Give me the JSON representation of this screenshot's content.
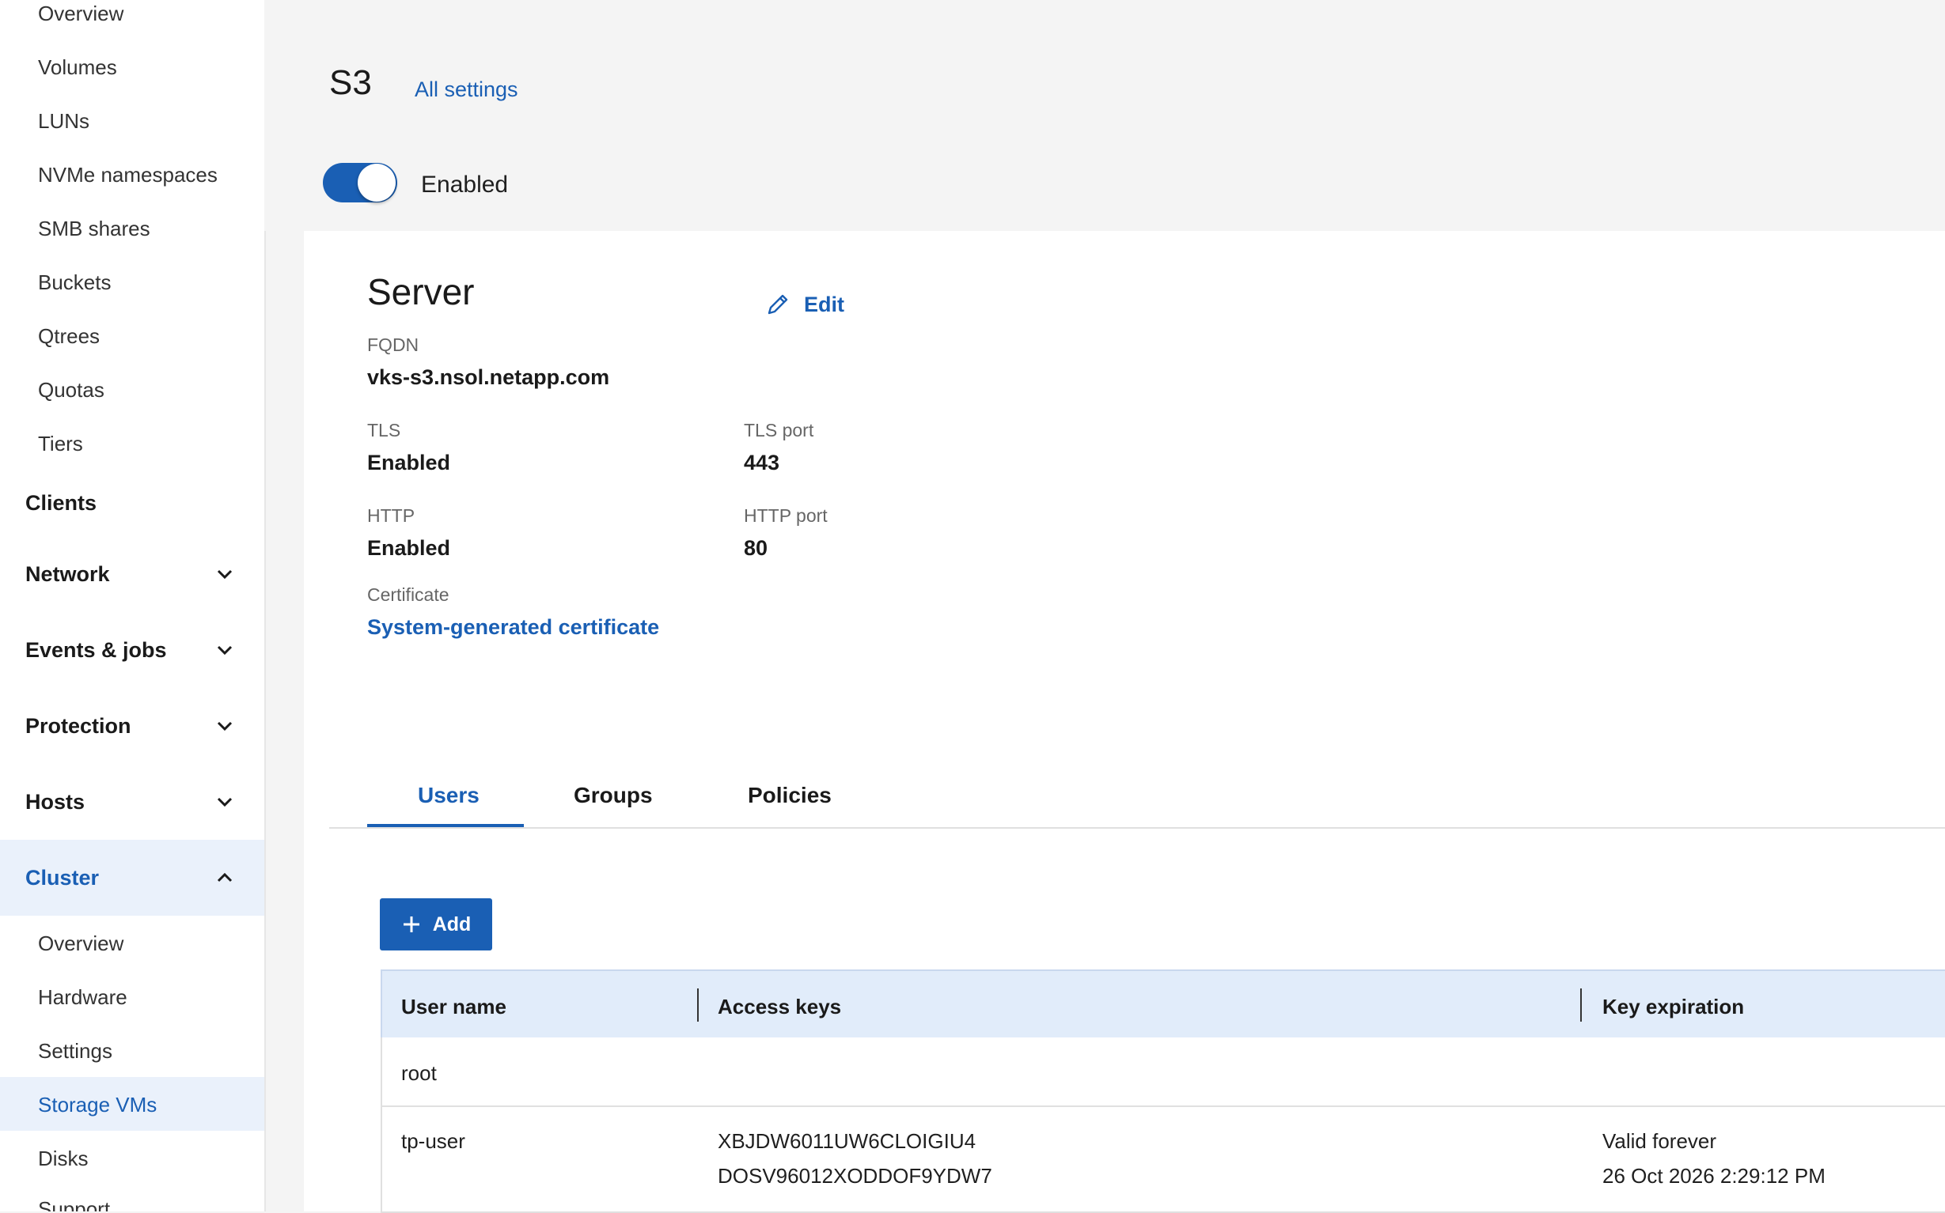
{
  "sidebar": {
    "storage_items": [
      "Overview",
      "Volumes",
      "LUNs",
      "NVMe namespaces",
      "SMB shares",
      "Buckets",
      "Qtrees",
      "Quotas",
      "Tiers"
    ],
    "sections": {
      "clients": "Clients",
      "network": "Network",
      "events": "Events & jobs",
      "protection": "Protection",
      "hosts": "Hosts",
      "cluster": "Cluster"
    },
    "cluster_items": [
      "Overview",
      "Hardware",
      "Settings",
      "Storage VMs",
      "Disks",
      "Support"
    ],
    "active_item": "Storage VMs"
  },
  "page": {
    "title": "S3",
    "all_settings": "All settings",
    "toggle_label": "Enabled",
    "toggle_on": true
  },
  "server": {
    "heading": "Server",
    "edit_label": "Edit",
    "fqdn_label": "FQDN",
    "fqdn_value": "vks-s3.nsol.netapp.com",
    "tls_label": "TLS",
    "tls_value": "Enabled",
    "tls_port_label": "TLS port",
    "tls_port_value": "443",
    "http_label": "HTTP",
    "http_value": "Enabled",
    "http_port_label": "HTTP port",
    "http_port_value": "80",
    "cert_label": "Certificate",
    "cert_value": "System-generated certificate"
  },
  "tabs": [
    {
      "label": "Users",
      "active": true
    },
    {
      "label": "Groups",
      "active": false
    },
    {
      "label": "Policies",
      "active": false
    }
  ],
  "toolbar": {
    "add_label": "Add"
  },
  "table": {
    "headers": [
      "User name",
      "Access keys",
      "Key expiration"
    ],
    "rows": [
      {
        "user": "root",
        "key1": "",
        "key2": "",
        "exp1": "",
        "exp2": ""
      },
      {
        "user": "tp-user",
        "key1": "XBJDW6011UW6CLOIGIU4",
        "key2": "DOSV96012XODDOF9YDW7",
        "exp1": "Valid forever",
        "exp2": "26 Oct 2026 2:29:12 PM"
      }
    ]
  },
  "colors": {
    "accent": "#1a5fb4",
    "header_bg": "#e1ecfa",
    "active_bg": "#eaf1fb"
  }
}
